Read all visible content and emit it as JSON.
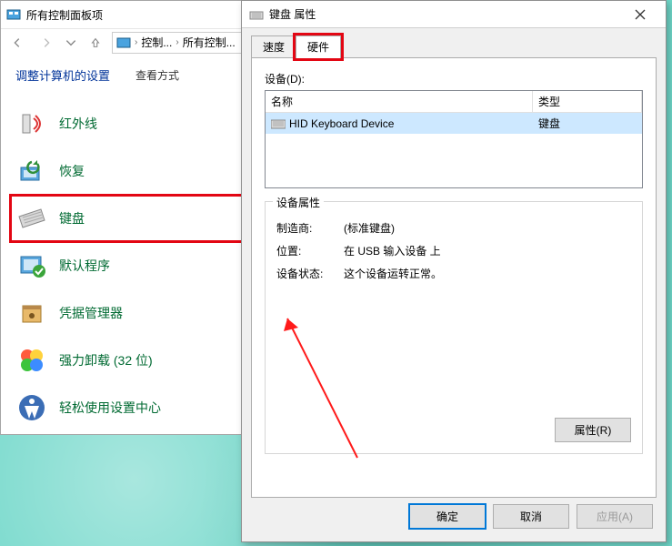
{
  "cp": {
    "window_title": "所有控制面板项",
    "breadcrumb": {
      "part1": "控制...",
      "part2": "所有控制..."
    },
    "head_title": "调整计算机的设置",
    "view_label": "查看方式",
    "items": [
      {
        "label": "红外线"
      },
      {
        "label": "恢复"
      },
      {
        "label": "键盘"
      },
      {
        "label": "默认程序"
      },
      {
        "label": "凭据管理器"
      },
      {
        "label": "强力卸载 (32 位)"
      },
      {
        "label": "轻松使用设置中心"
      }
    ]
  },
  "dlg": {
    "title": "键盘 属性",
    "tabs": {
      "speed": "速度",
      "hardware": "硬件"
    },
    "devices_label": "设备(D):",
    "col_name": "名称",
    "col_type": "类型",
    "row_name": "HID Keyboard Device",
    "row_type": "键盘",
    "fieldset_title": "设备属性",
    "props": {
      "manufacturer_k": "制造商:",
      "manufacturer_v": "(标准键盘)",
      "location_k": "位置:",
      "location_v": "在 USB 输入设备 上",
      "status_k": "设备状态:",
      "status_v": "这个设备运转正常。"
    },
    "properties_btn": "属性(R)",
    "ok": "确定",
    "cancel": "取消",
    "apply": "应用(A)"
  }
}
